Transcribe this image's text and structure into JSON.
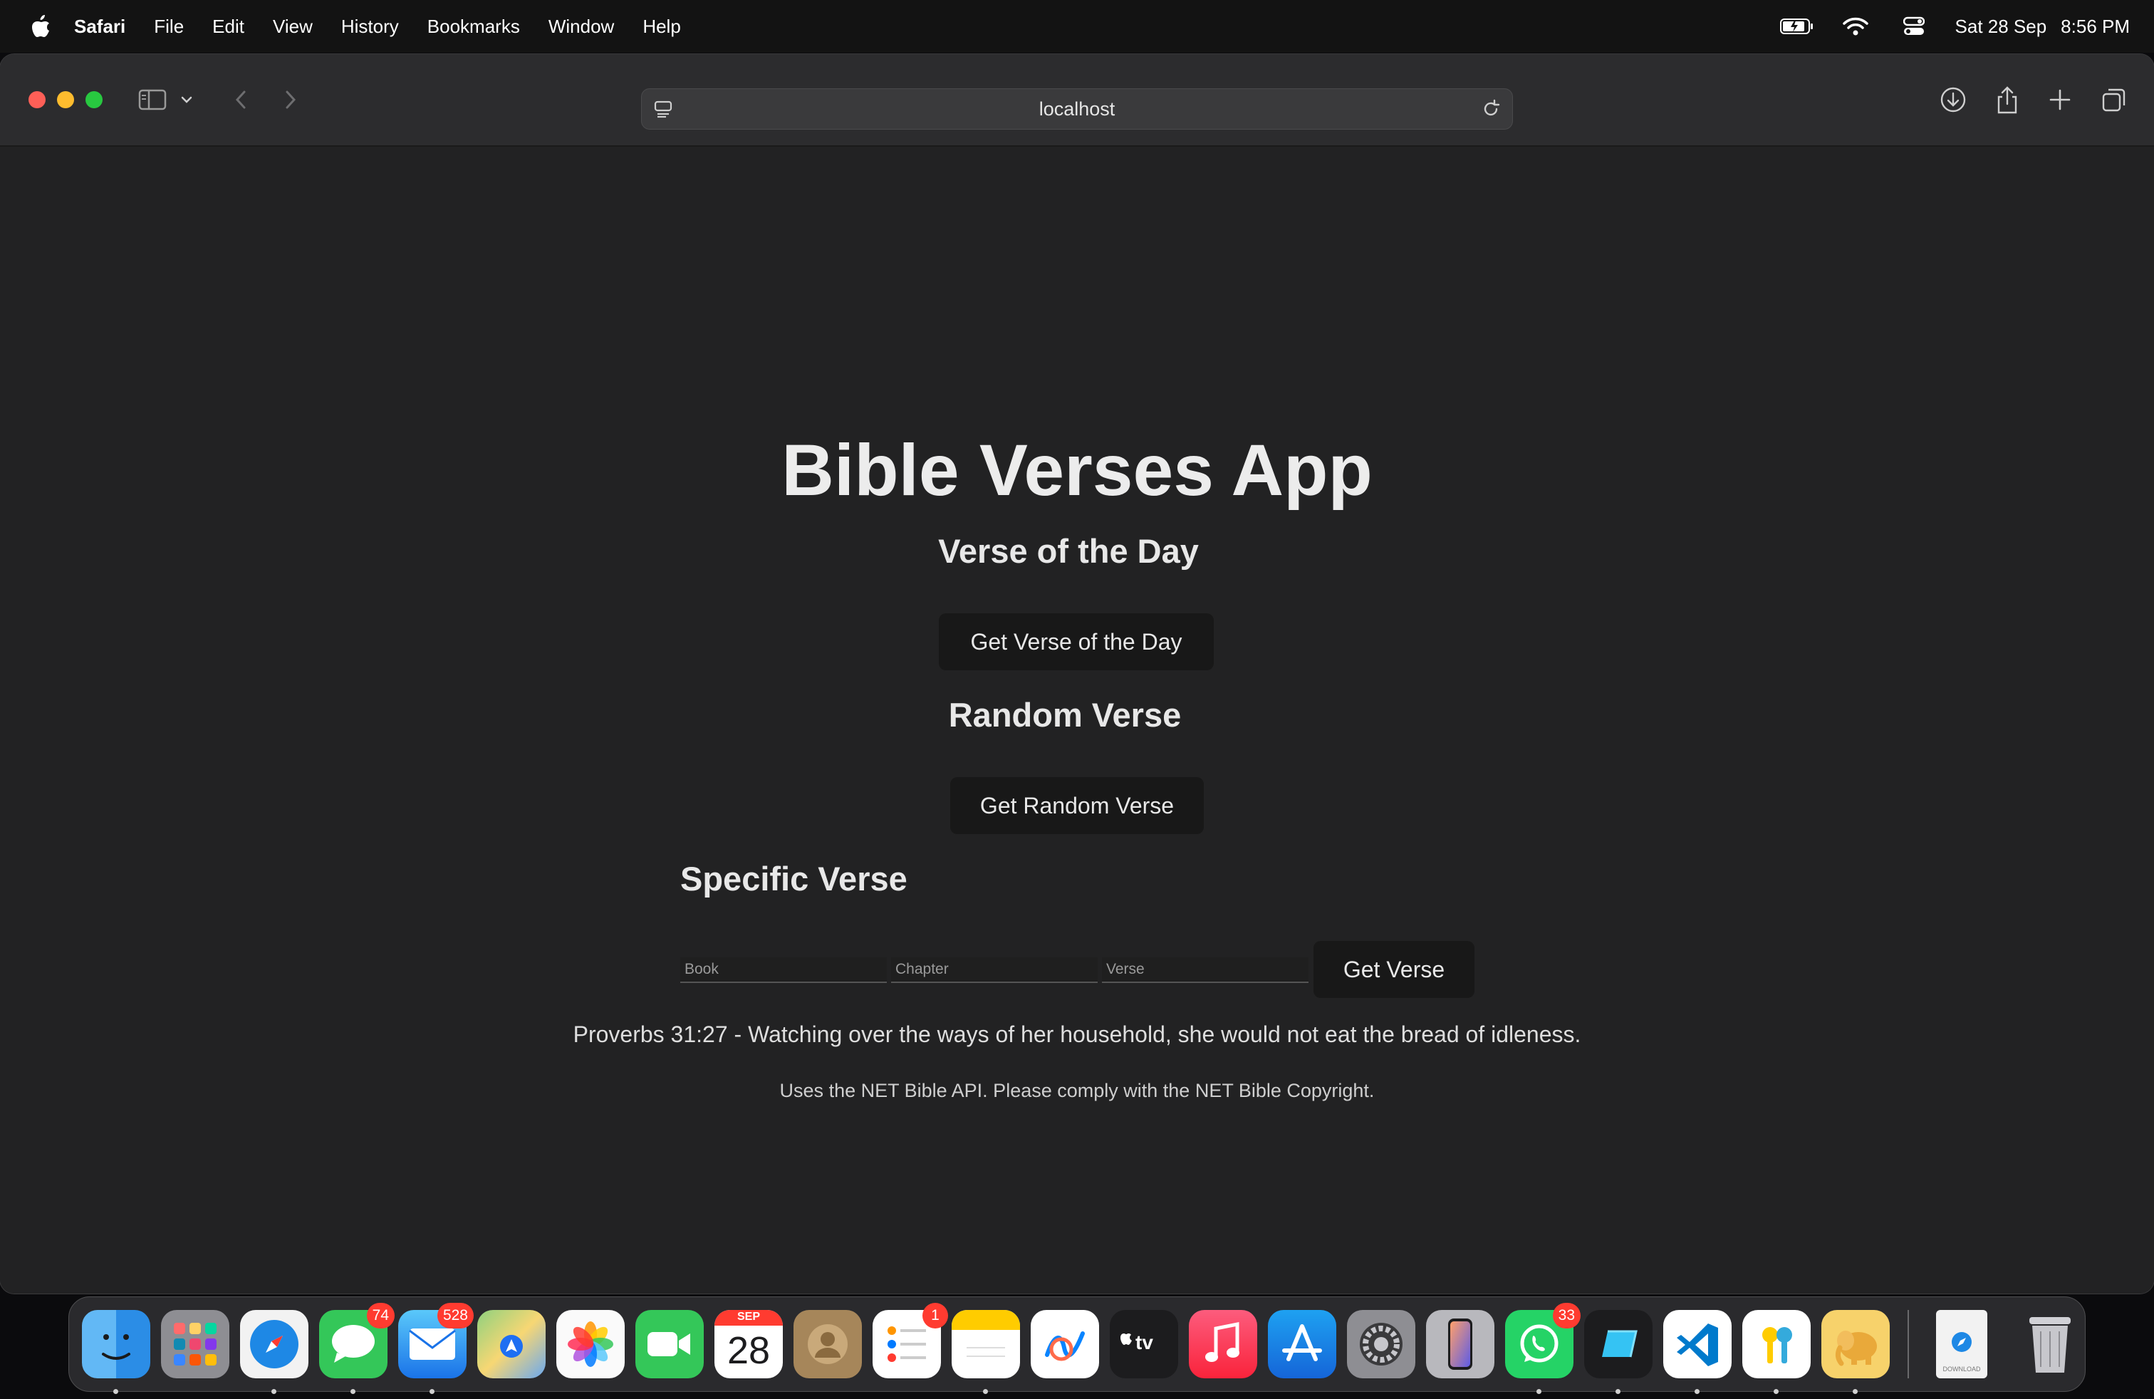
{
  "menubar": {
    "app_name": "Safari",
    "items": [
      "File",
      "Edit",
      "View",
      "History",
      "Bookmarks",
      "Window",
      "Help"
    ],
    "date": "Sat 28 Sep",
    "time": "8:56 PM"
  },
  "browser": {
    "url": "localhost"
  },
  "page": {
    "title": "Bible Verses App",
    "verse_of_day": {
      "heading": "Verse of the Day",
      "button": "Get Verse of the Day"
    },
    "random_verse": {
      "heading": "Random Verse",
      "button": "Get Random Verse"
    },
    "specific_verse": {
      "heading": "Specific Verse",
      "book_placeholder": "Book",
      "chapter_placeholder": "Chapter",
      "verse_placeholder": "Verse",
      "button": "Get Verse"
    },
    "result": "Proverbs 31:27 - Watching over the ways of her household, she would not eat the bread of idleness.",
    "footnote": "Uses the NET Bible API. Please comply with the NET Bible Copyright."
  },
  "dock": {
    "apps": [
      {
        "name": "finder",
        "badge": ""
      },
      {
        "name": "launchpad",
        "badge": ""
      },
      {
        "name": "safari",
        "badge": ""
      },
      {
        "name": "messages",
        "badge": "74"
      },
      {
        "name": "mail",
        "badge": "528"
      },
      {
        "name": "maps",
        "badge": ""
      },
      {
        "name": "photos",
        "badge": ""
      },
      {
        "name": "facetime",
        "badge": ""
      },
      {
        "name": "calendar",
        "badge": "",
        "month": "SEP",
        "day": "28"
      },
      {
        "name": "contacts",
        "badge": ""
      },
      {
        "name": "reminders",
        "badge": "1"
      },
      {
        "name": "notes",
        "badge": ""
      },
      {
        "name": "freeform",
        "badge": ""
      },
      {
        "name": "apple-tv",
        "badge": "",
        "label": "tv"
      },
      {
        "name": "music",
        "badge": ""
      },
      {
        "name": "app-store",
        "badge": ""
      },
      {
        "name": "system-settings",
        "badge": ""
      },
      {
        "name": "iphone-mirroring",
        "badge": ""
      },
      {
        "name": "whatsapp",
        "badge": "33"
      },
      {
        "name": "app-tile",
        "badge": ""
      },
      {
        "name": "vscode",
        "badge": ""
      },
      {
        "name": "passwords",
        "badge": ""
      },
      {
        "name": "pages-elephant",
        "badge": ""
      }
    ],
    "downloads_label": "DOWNLOAD",
    "colors": {
      "badge": "#ff3b30",
      "window_bg": "#222223",
      "button_bg": "#181818"
    }
  }
}
